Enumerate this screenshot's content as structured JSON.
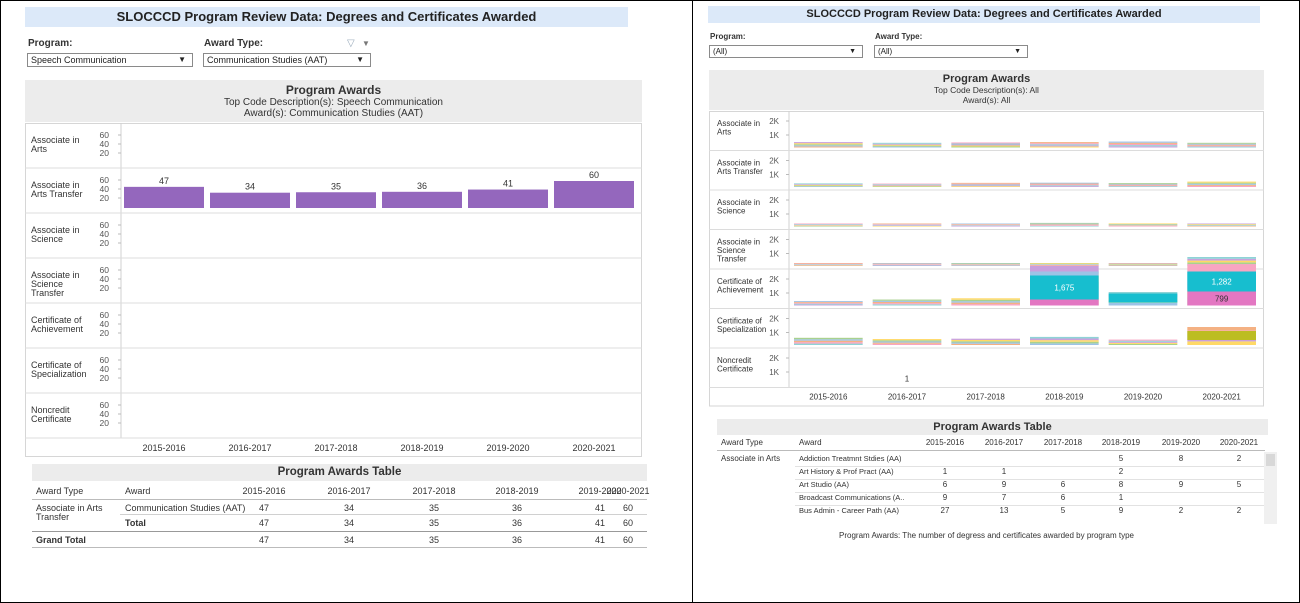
{
  "colors": {
    "banner_bg": "#dce9f9",
    "bar_purple": "#9467bd",
    "teal": "#17becf",
    "pink": "#e377c2",
    "olive": "#bcbd22",
    "orange": "#f2a65a",
    "grey_band": "#ececec"
  },
  "left": {
    "title": "SLOCCCD Program Review Data: Degrees and Certificates Awarded",
    "program_label": "Program:",
    "program_value": "Speech Communication",
    "award_label": "Award Type:",
    "award_value": "Communication Studies (AAT)",
    "filter_icon": "filter-icon",
    "chart_title": "Program Awards",
    "chart_sub1": "Top Code Description(s): Speech Communication",
    "chart_sub2": "Award(s): Communication Studies (AAT)",
    "table_title": "Program Awards Table",
    "table_headers": [
      "Award Type",
      "Award",
      "2015-2016",
      "2016-2017",
      "2017-2018",
      "2018-2019",
      "2019-2020",
      "2020-2021"
    ],
    "table_rows": [
      {
        "type": "Associate in Arts",
        "type2": "Transfer",
        "award": "Communication Studies (AAT)",
        "vals": [
          "47",
          "34",
          "35",
          "36",
          "41",
          "60"
        ]
      },
      {
        "type": "",
        "type2": "",
        "award": "Total",
        "vals": [
          "47",
          "34",
          "35",
          "36",
          "41",
          "60"
        ]
      }
    ],
    "grand_total_label": "Grand Total",
    "grand_total_vals": [
      "47",
      "34",
      "35",
      "36",
      "41",
      "60"
    ]
  },
  "right": {
    "title": "SLOCCCD Program Review Data: Degrees and Certificates Awarded",
    "program_label": "Program:",
    "program_value": "(All)",
    "award_label": "Award Type:",
    "award_value": "(All)",
    "chart_title": "Program Awards",
    "chart_sub1": "Top Code Description(s): All",
    "chart_sub2": "Award(s): All",
    "table_title": "Program Awards Table",
    "table_headers": [
      "Award Type",
      "Award",
      "2015-2016",
      "2016-2017",
      "2017-2018",
      "2018-2019",
      "2019-2020",
      "2020-2021"
    ],
    "table_type": "Associate in Arts",
    "table_rows": [
      {
        "award": "Addiction Treatmnt Stdies (AA)",
        "vals": [
          "",
          "",
          "",
          "5",
          "8",
          "2"
        ]
      },
      {
        "award": "Art History & Prof Pract (AA)",
        "vals": [
          "1",
          "1",
          "",
          "2",
          "",
          ""
        ]
      },
      {
        "award": "Art Studio (AA)",
        "vals": [
          "6",
          "9",
          "6",
          "8",
          "9",
          "5"
        ]
      },
      {
        "award": "Broadcast Communications (A..",
        "vals": [
          "9",
          "7",
          "6",
          "1",
          "",
          ""
        ]
      },
      {
        "award": "Bus Admin - Career Path (AA)",
        "vals": [
          "27",
          "13",
          "5",
          "9",
          "2",
          "2"
        ]
      }
    ],
    "footnote": "Program Awards: The number of degress and certificates awarded by program type"
  },
  "chart_data": [
    {
      "type": "bar",
      "title": "Program Awards",
      "subtitle": "Top Code Description(s): Speech Communication / Award(s): Communication Studies (AAT)",
      "rows": [
        "Associate in Arts",
        "Associate in Arts Transfer",
        "Associate in Science",
        "Associate in Science Transfer",
        "Certificate of Achievement",
        "Certificate of Specialization",
        "Noncredit Certificate"
      ],
      "row_labels": [
        [
          "Associate in",
          "Arts"
        ],
        [
          "Associate in",
          "Arts Transfer"
        ],
        [
          "Associate in",
          "Science"
        ],
        [
          "Associate in",
          "Science",
          "Transfer"
        ],
        [
          "Certificate of",
          "Achievement"
        ],
        [
          "Certificate of",
          "Specialization"
        ],
        [
          "Noncredit",
          "Certificate"
        ]
      ],
      "categories": [
        "2015-2016",
        "2016-2017",
        "2017-2018",
        "2018-2019",
        "2019-2020",
        "2020-2021"
      ],
      "yticks": [
        "60",
        "40",
        "20"
      ],
      "ylim": [
        0,
        70
      ],
      "series": [
        {
          "name": "Communication Studies (AAT)",
          "row": 1,
          "values": [
            47,
            34,
            35,
            36,
            41,
            60
          ]
        }
      ]
    },
    {
      "type": "bar",
      "stacked": true,
      "title": "Program Awards",
      "subtitle": "Top Code Description(s): All / Award(s): All",
      "rows": [
        "Associate in Arts",
        "Associate in Arts Transfer",
        "Associate in Science",
        "Associate in Science Transfer",
        "Certificate of Achievement",
        "Certificate of Specialization",
        "Noncredit Certificate"
      ],
      "row_labels": [
        [
          "Associate in",
          "Arts"
        ],
        [
          "Associate in",
          "Arts Transfer"
        ],
        [
          "Associate in",
          "Science"
        ],
        [
          "Associate in",
          "Science",
          "Transfer"
        ],
        [
          "Certificate of",
          "Achievement"
        ],
        [
          "Certificate of",
          "Specialization"
        ],
        [
          "Noncredit",
          "Certificate"
        ]
      ],
      "categories": [
        "2015-2016",
        "2016-2017",
        "2017-2018",
        "2018-2019",
        "2019-2020",
        "2020-2021"
      ],
      "yticks": [
        "2K",
        "1K"
      ],
      "ylim": [
        0,
        2600
      ],
      "row_totals": [
        [
          300,
          260,
          280,
          300,
          330,
          260
        ],
        [
          200,
          190,
          230,
          240,
          220,
          300
        ],
        [
          120,
          150,
          140,
          200,
          170,
          140
        ],
        [
          120,
          110,
          110,
          150,
          150,
          500
        ],
        [
          250,
          330,
          400,
          2200,
          750,
          2300
        ],
        [
          400,
          330,
          350,
          450,
          300,
          1000
        ],
        [
          0,
          1,
          0,
          0,
          0,
          0
        ]
      ],
      "highlights": [
        {
          "row": 4,
          "category": "2018-2019",
          "value": 1675,
          "label": "1,675"
        },
        {
          "row": 4,
          "category": "2020-2021",
          "value": 1282,
          "label": "1,282"
        },
        {
          "row": 4,
          "category": "2020-2021",
          "value": 799,
          "label": "799"
        },
        {
          "row": 6,
          "category": "2016-2017",
          "value": 1,
          "label": "1"
        }
      ]
    }
  ]
}
